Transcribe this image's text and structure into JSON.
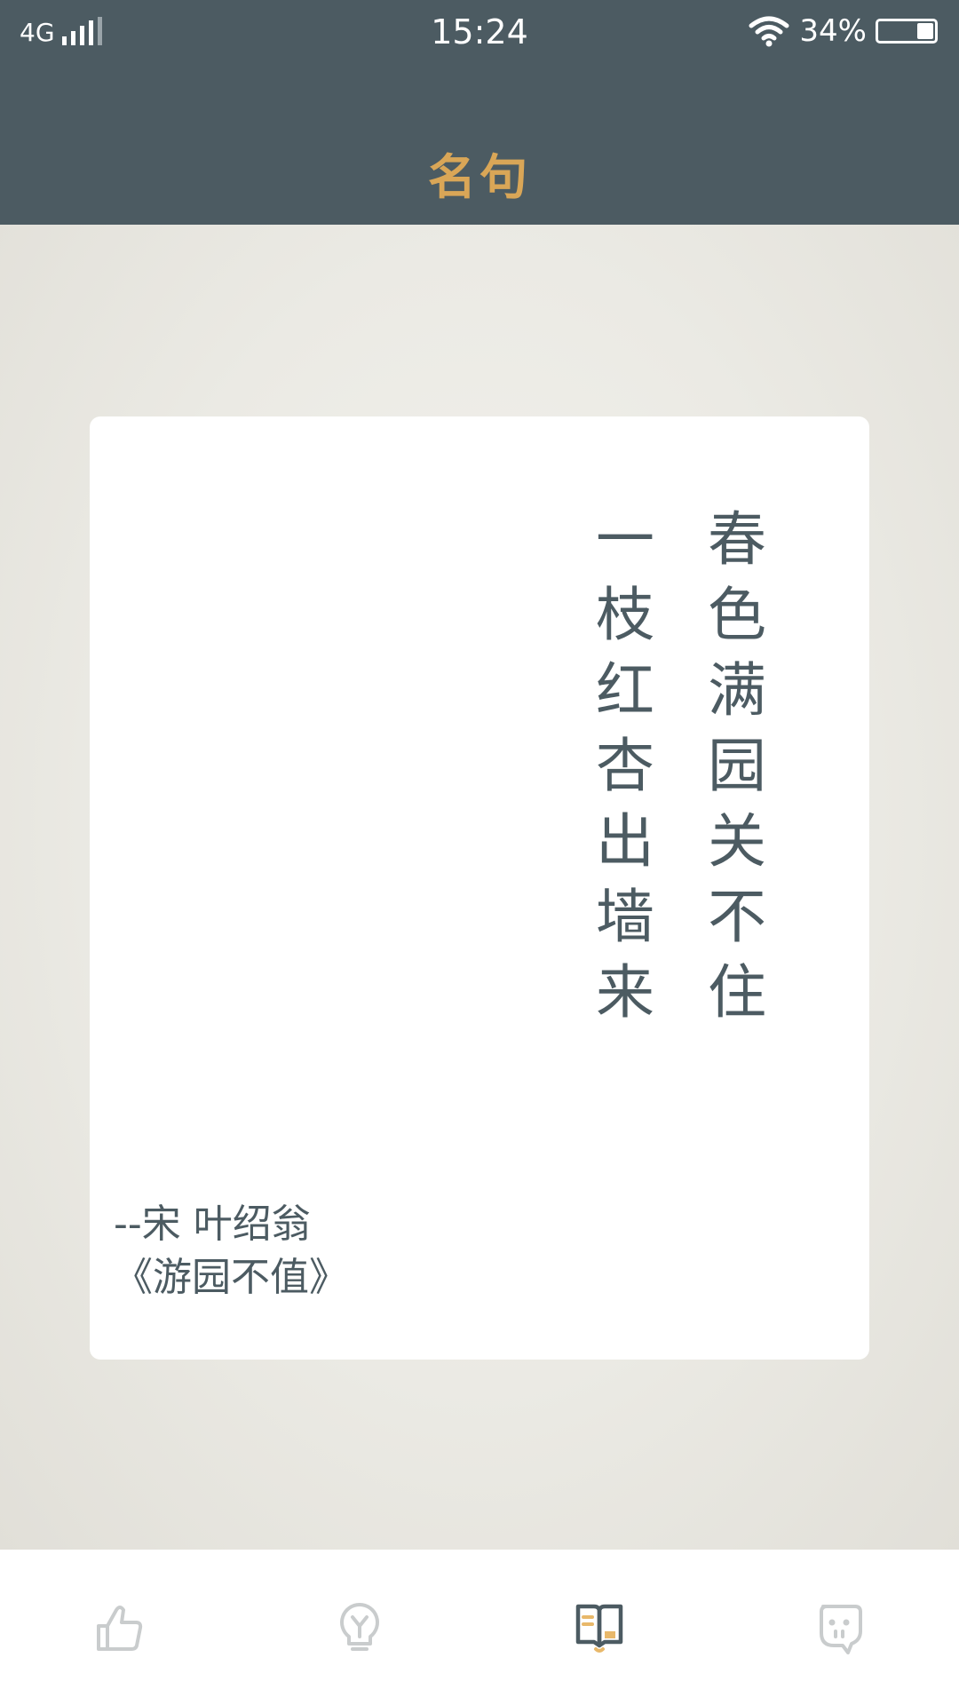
{
  "status_bar": {
    "network": "4G",
    "time": "15:24",
    "battery_percent": "34%"
  },
  "header": {
    "title": "名句"
  },
  "quote": {
    "columns": [
      [
        "春",
        "色",
        "满",
        "园",
        "关",
        "不",
        "住"
      ],
      [
        "一",
        "枝",
        "红",
        "杏",
        "出",
        "墙",
        "来"
      ]
    ],
    "author_line": "--宋 叶绍翁",
    "work_title": "《游园不值》"
  },
  "bottom_nav": {
    "items": [
      {
        "icon": "thumbs-up-icon",
        "active": false
      },
      {
        "icon": "lightbulb-icon",
        "active": false
      },
      {
        "icon": "book-icon",
        "active": true
      },
      {
        "icon": "face-icon",
        "active": false
      }
    ]
  },
  "colors": {
    "header_bg": "#4c5b62",
    "title": "#d9a657",
    "text": "#4c5b62",
    "nav_inactive": "#c9cccd",
    "nav_active": "#4c5b62",
    "nav_accent": "#e8b86a"
  }
}
